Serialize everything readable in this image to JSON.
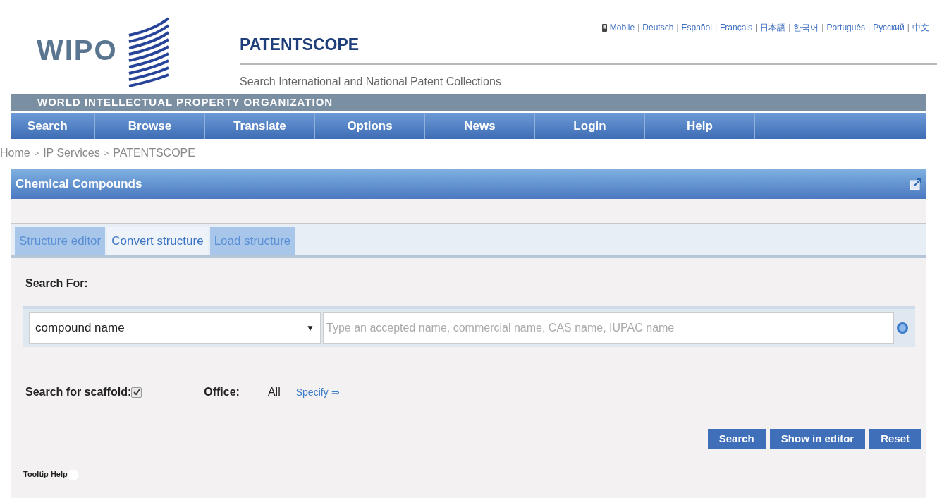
{
  "header": {
    "logo_text": "WIPO",
    "product": "PATENTSCOPE",
    "subtitle": "Search International and National Patent Collections",
    "org_band": "WORLD INTELLECTUAL PROPERTY ORGANIZATION",
    "languages": [
      "Mobile",
      "Deutsch",
      "Español",
      "Français",
      "日本語",
      "한국어",
      "Português",
      "Русский",
      "中文"
    ],
    "language_separator": "|"
  },
  "nav": [
    "Search",
    "Browse",
    "Translate",
    "Options",
    "News",
    "Login",
    "Help"
  ],
  "breadcrumb": {
    "items": [
      "Home",
      "IP Services",
      "PATENTSCOPE"
    ],
    "separator": ">"
  },
  "panel": {
    "title": "Chemical Compounds",
    "tabs": [
      {
        "label": "Structure editor",
        "selected": false
      },
      {
        "label": "Convert structure",
        "selected": true
      },
      {
        "label": "Load structure",
        "selected": false
      }
    ],
    "search_for_label": "Search For:",
    "select": {
      "value": "compound name",
      "arrow": "▼"
    },
    "query": {
      "placeholder": "Type an accepted name, commercial name, CAS name, IUPAC name"
    },
    "scaffold": {
      "label": "Search for scaffold:",
      "checked": true
    },
    "office": {
      "label": "Office:",
      "value": "All",
      "link": "Specify ⇒"
    },
    "buttons": [
      "Search",
      "Show in editor",
      "Reset"
    ],
    "tooltip_help": {
      "label": "Tooltip Help",
      "checked": false
    }
  }
}
